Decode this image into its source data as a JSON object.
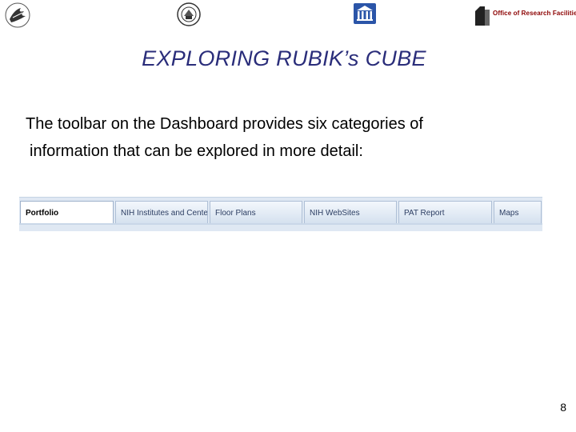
{
  "header": {
    "logos": [
      "hhs-logo",
      "nih-seal-icon",
      "nih-building-icon",
      "orf-logo"
    ],
    "orf_label": "Office of Research Facilities"
  },
  "title": "EXPLORING RUBIK’s CUBE",
  "body": {
    "line1": "The toolbar on the Dashboard provides six categories of",
    "line2": "information that can be explored in more detail:"
  },
  "toolbar": {
    "tabs": [
      {
        "label": "Portfolio",
        "active": true
      },
      {
        "label": "NIH Institutes and Centers",
        "active": false
      },
      {
        "label": "Floor Plans",
        "active": false
      },
      {
        "label": "NIH WebSites",
        "active": false
      },
      {
        "label": "PAT Report",
        "active": false
      },
      {
        "label": "Maps",
        "active": false
      }
    ]
  },
  "page_number": "8",
  "colors": {
    "title": "#2a2d7a",
    "orf_text": "#8b0000",
    "toolbar_bg": "#dfe8f3"
  }
}
